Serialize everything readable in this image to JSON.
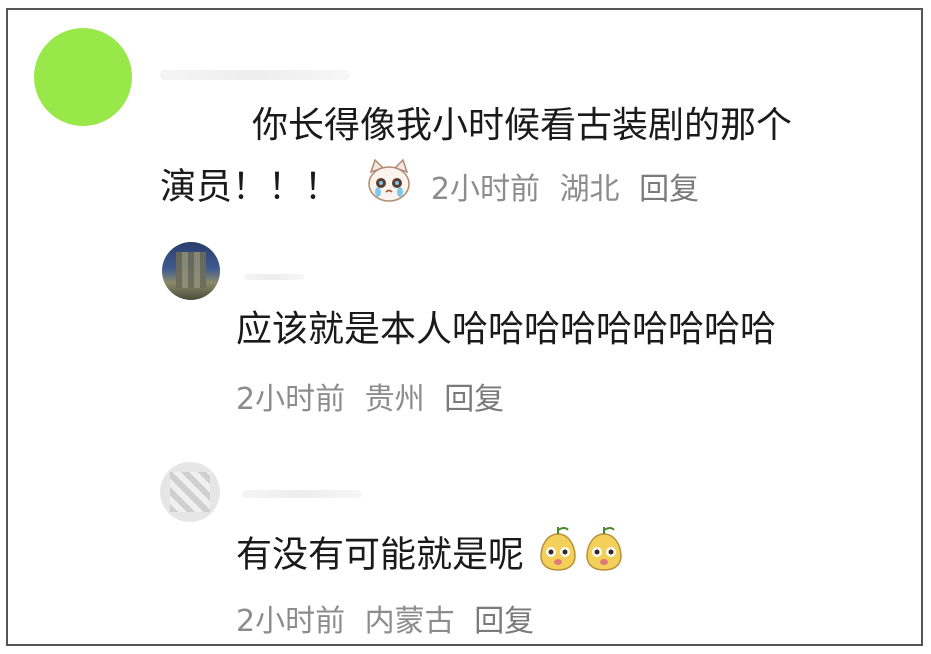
{
  "comments": [
    {
      "avatar_color": "#99e84a",
      "line1": "你长得像我小时候看古装剧的那个",
      "line2": "演员！！！",
      "emoji": "crying-cat-emoji",
      "time": "2小时前",
      "location": "湖北",
      "reply_label": "回复"
    },
    {
      "text": "应该就是本人哈哈哈哈哈哈哈哈哈",
      "time": "2小时前",
      "location": "贵州",
      "reply_label": "回复"
    },
    {
      "text": "有没有可能就是呢",
      "emoji": "pear-face-emoji",
      "time": "2小时前",
      "location": "内蒙古",
      "reply_label": "回复"
    }
  ]
}
